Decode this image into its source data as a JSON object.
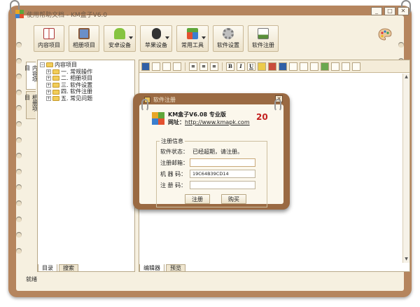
{
  "window": {
    "title": "使用帮助文档 - KM盒子V6.0",
    "minimize_glyph": "_",
    "maximize_glyph": "□",
    "close_glyph": "✕"
  },
  "toolbar": {
    "items": [
      {
        "label": "内容项目",
        "icon": "book-icon",
        "has_dropdown": false
      },
      {
        "label": "相册项目",
        "icon": "photo-album-icon",
        "has_dropdown": false
      },
      {
        "label": "安卓设备",
        "icon": "android-icon",
        "has_dropdown": true
      },
      {
        "label": "苹果设备",
        "icon": "apple-icon",
        "has_dropdown": true
      },
      {
        "label": "常用工具",
        "icon": "tools-icon",
        "has_dropdown": true
      },
      {
        "label": "软件设置",
        "icon": "gear-icon",
        "has_dropdown": false
      },
      {
        "label": "软件注册",
        "icon": "register-icon",
        "has_dropdown": false
      }
    ],
    "skin_icon": "palette-icon"
  },
  "sidebar": {
    "vertical_tabs": [
      "内容项目",
      "相册项目"
    ],
    "tree": {
      "root": "内容项目",
      "children": [
        "一. 常规操作",
        "二. 相册项目",
        "三. 软件设置",
        "四. 软件注册",
        "五. 常见问题"
      ]
    },
    "bottom_tabs": [
      "目录",
      "搜索"
    ]
  },
  "editor": {
    "bottom_tabs": [
      "编辑器",
      "预览"
    ]
  },
  "statusbar": {
    "text": "就绪"
  },
  "dialog": {
    "title": "软件注册",
    "close_glyph": "✕",
    "product": "KM盒子V6.08 专业版",
    "website_label": "网址：",
    "website_url": "http://www.kmapk.com",
    "badge_number": "20",
    "group_title": "注册信息",
    "status_label": "软件状态：",
    "status_value": "已经超期，请注册。",
    "email_label": "注册邮箱：",
    "email_value": "",
    "machine_label": "机 器 码：",
    "machine_value": "19C64B39CD14",
    "code_label": "注 册 码：",
    "code_value": "",
    "register_button": "注册",
    "buy_button": "购买"
  },
  "colors": {
    "frame": "#b5855e",
    "paper": "#f6f0e0",
    "dialog_frame": "#9a6a43",
    "badge_red": "#c3201f"
  }
}
